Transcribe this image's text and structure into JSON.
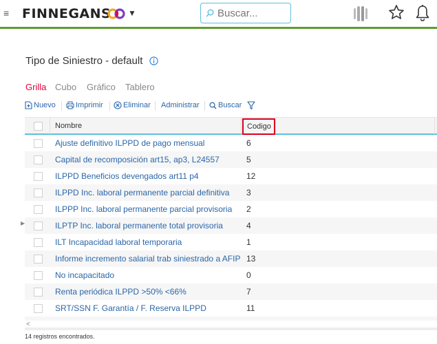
{
  "header": {
    "brand": "FINNEGANS",
    "search_placeholder": "Buscar...",
    "brand_colors": [
      "#f5a623",
      "#e4003b",
      "#7b3fbf"
    ],
    "accent_bar": "#5e9b2f"
  },
  "page": {
    "title": "Tipo de Siniestro - default"
  },
  "tabs": [
    {
      "label": "Grilla",
      "active": true
    },
    {
      "label": "Cubo",
      "active": false
    },
    {
      "label": "Gráfico",
      "active": false
    },
    {
      "label": "Tablero",
      "active": false
    }
  ],
  "toolbar": {
    "nuevo": "Nuevo",
    "imprimir": "Imprimir",
    "eliminar": "Eliminar",
    "administrar": "Administrar",
    "buscar": "Buscar"
  },
  "grid": {
    "columns": {
      "nombre": "Nombre",
      "codigo": "Codigo"
    },
    "rows": [
      {
        "nombre": "Ajuste definitivo ILPPD de pago mensual",
        "codigo": "6"
      },
      {
        "nombre": "Capital de recomposición art15, ap3, L24557",
        "codigo": "5"
      },
      {
        "nombre": "ILPPD Beneficios devengados art11 p4",
        "codigo": "12"
      },
      {
        "nombre": "ILPPD Inc. laboral permanente parcial definitiva",
        "codigo": "3"
      },
      {
        "nombre": "ILPPP Inc. laboral permanente parcial provisoria",
        "codigo": "2"
      },
      {
        "nombre": "ILPTP Inc. laboral permanente total provisoria",
        "codigo": "4"
      },
      {
        "nombre": "ILT Incapacidad laboral temporaria",
        "codigo": "1"
      },
      {
        "nombre": "Informe incremento salarial trab siniestrado a AFIP",
        "codigo": "13"
      },
      {
        "nombre": "No incapacitado",
        "codigo": "0"
      },
      {
        "nombre": "Renta periódica ILPPD >50% <66%",
        "codigo": "7"
      },
      {
        "nombre": "SRT/SSN F. Garantía / F. Reserva ILPPD",
        "codigo": "11"
      }
    ]
  },
  "footer": {
    "count_text": "14 registros encontrados."
  }
}
